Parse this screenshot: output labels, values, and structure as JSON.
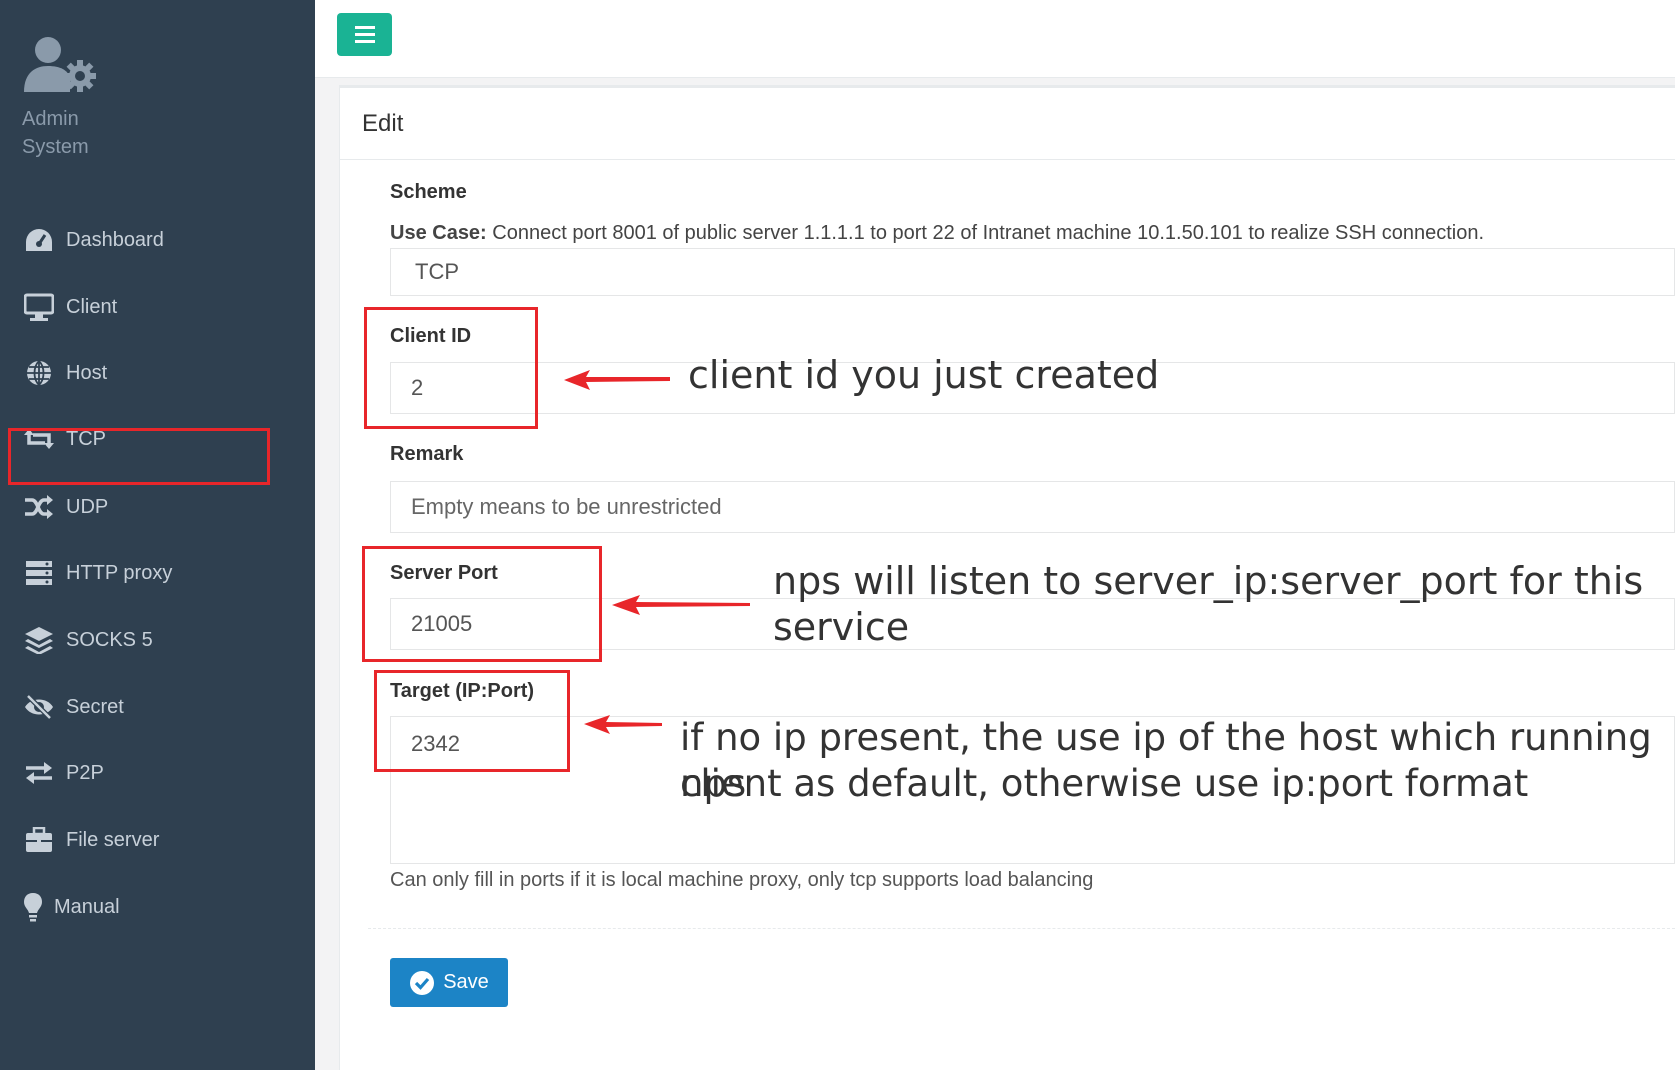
{
  "sidebar": {
    "profile": {
      "line1": "Admin",
      "line2": "System"
    },
    "items": [
      {
        "label": "Dashboard",
        "icon": "dashboard-icon"
      },
      {
        "label": "Client",
        "icon": "monitor-icon"
      },
      {
        "label": "Host",
        "icon": "globe-icon"
      },
      {
        "label": "TCP",
        "icon": "retweet-icon"
      },
      {
        "label": "UDP",
        "icon": "shuffle-icon"
      },
      {
        "label": "HTTP proxy",
        "icon": "server-icon"
      },
      {
        "label": "SOCKS 5",
        "icon": "layers-icon"
      },
      {
        "label": "Secret",
        "icon": "eye-slash-icon"
      },
      {
        "label": "P2P",
        "icon": "exchange-icon"
      },
      {
        "label": "File server",
        "icon": "briefcase-icon"
      },
      {
        "label": "Manual",
        "icon": "lightbulb-icon"
      }
    ],
    "active": "TCP"
  },
  "topbar": {
    "menu_icon": "hamburger-icon"
  },
  "panel": {
    "title": "Edit",
    "scheme": {
      "label": "Scheme",
      "use_case_label": "Use Case:",
      "use_case_text": " Connect port 8001 of public server 1.1.1.1 to port 22 of Intranet machine 10.1.50.101 to realize SSH connection.",
      "value": "TCP"
    },
    "client_id": {
      "label": "Client ID",
      "value": "2"
    },
    "remark": {
      "label": "Remark",
      "placeholder": "Empty means to be unrestricted"
    },
    "server_port": {
      "label": "Server Port",
      "value": "21005"
    },
    "target": {
      "label": "Target (IP:Port)",
      "value": "2342",
      "help": "Can only fill in ports if it is local machine proxy, only tcp supports load balancing"
    },
    "save_label": "Save"
  },
  "annotations": {
    "client_id": "client id you just created",
    "server_port_1": "nps will listen to server_ip:server_port for this",
    "server_port_2": "service",
    "target_1": "if no ip present, the use ip of the host which running nps",
    "target_2": "client as default, otherwise use ip:port format",
    "color": "#e8262a"
  }
}
